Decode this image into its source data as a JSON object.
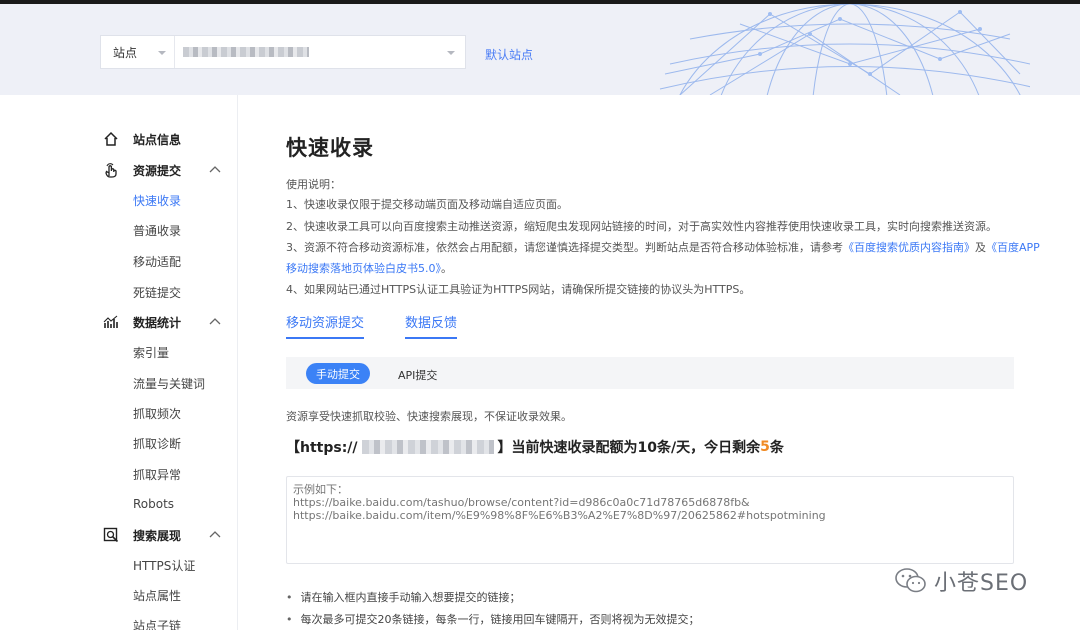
{
  "header": {
    "site_prefix": "站点",
    "default_site_link": "默认站点"
  },
  "sidebar": {
    "groups": [
      {
        "label": "站点信息",
        "icon": "home-icon"
      },
      {
        "label": "资源提交",
        "icon": "hand-pointer-icon",
        "items": [
          "快速收录",
          "普通收录",
          "移动适配",
          "死链提交"
        ],
        "active": "快速收录"
      },
      {
        "label": "数据统计",
        "icon": "bar-chart-icon",
        "items": [
          "索引量",
          "流量与关键词",
          "抓取频次",
          "抓取诊断",
          "抓取异常",
          "Robots"
        ]
      },
      {
        "label": "搜索展现",
        "icon": "search-doc-icon",
        "items": [
          "HTTPS认证",
          "站点属性",
          "站点子链"
        ]
      }
    ]
  },
  "main": {
    "title": "快速收录",
    "usage_title": "使用说明：",
    "note1": "1、快速收录仅限于提交移动端页面及移动端自适应页面。",
    "note2": "2、快速收录工具可以向百度搜索主动推送资源，缩短爬虫发现网站链接的时间，对于高实效性内容推荐使用快速收录工具，实时向搜索推送资源。",
    "note3_a": "3、资源不符合移动资源标准，依然会占用配额，请您谨慎选择提交类型。判断站点是否符合移动体验标准，请参考",
    "note3_link1": "《百度搜索优质内容指南》",
    "note3_b": "及",
    "note3_link2a": "《百度APP",
    "note3_link2b": "移动搜索落地页体验白皮书5.0》",
    "note3_end": "。",
    "note4": "4、如果网站已通过HTTPS认证工具验证为HTTPS网站，请确保所提交链接的协议头为HTTPS。",
    "tabs": [
      "移动资源提交",
      "数据反馈"
    ],
    "subtabs": [
      "手动提交",
      "API提交"
    ],
    "hint": "资源享受快速抓取校验、快速搜索展现，不保证收录效果。",
    "quota_prefix": "【https://",
    "quota_mid": "】当前快速收录配额为10条/天，今日剩余",
    "quota_remaining": "5",
    "quota_suffix": "条",
    "textarea_placeholder": "示例如下：\nhttps://baike.baidu.com/tashuo/browse/content?id=d986c0a0c71d78765d6878fb&\nhttps://baike.baidu.com/item/%E9%98%8F%E6%B3%A2%E7%8D%97/20625862#hotspotmining",
    "bullets": [
      "请在输入框内直接手动输入想要提交的链接；",
      "每次最多可提交20条链接，每条一行，链接用回车键隔开，否则将视为无效提交；"
    ]
  },
  "watermark": {
    "text": "小苍SEO"
  },
  "colors": {
    "accent": "#3b78f5",
    "highlight": "#f08a24"
  }
}
